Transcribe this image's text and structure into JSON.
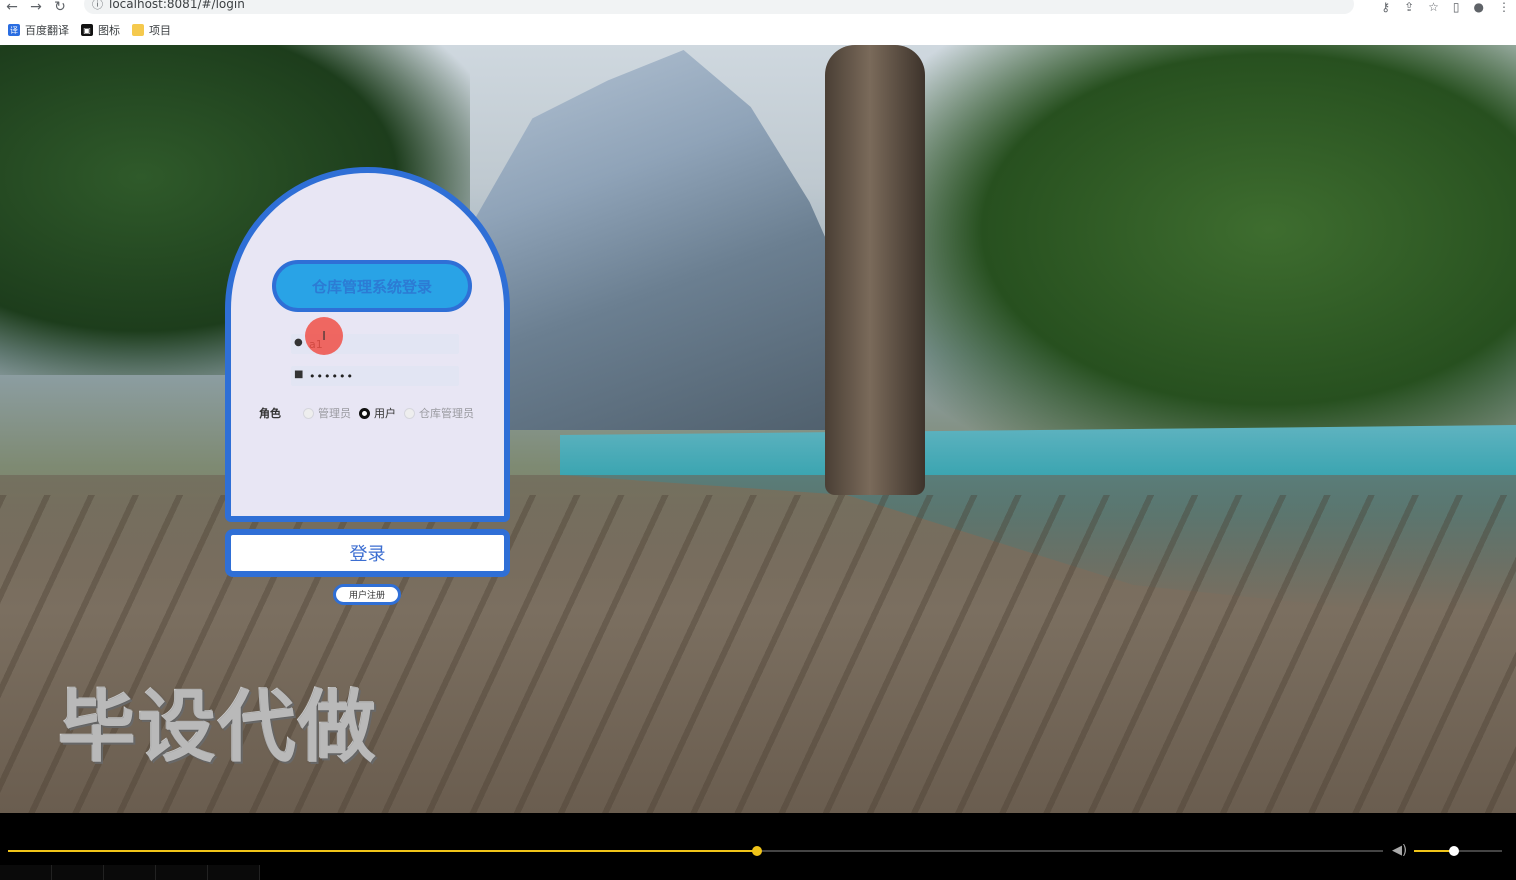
{
  "browser": {
    "url": "localhost:8081/#/login",
    "bookmarks": [
      {
        "label": "百度翻译",
        "icon": "translate-icon"
      },
      {
        "label": "图标",
        "icon": "image-icon"
      },
      {
        "label": "项目",
        "icon": "folder-icon"
      }
    ]
  },
  "login": {
    "title": "仓库管理系统登录",
    "username_value": "a1",
    "password_value": "••••••",
    "role_label": "角色",
    "roles": [
      {
        "label": "管理员",
        "checked": false
      },
      {
        "label": "用户",
        "checked": true
      },
      {
        "label": "仓库管理员",
        "checked": false
      }
    ],
    "login_button": "登录",
    "register_button": "用户注册"
  },
  "watermark": "毕设代做",
  "player": {
    "progress": 0.545,
    "volume": 0.45
  },
  "colors": {
    "accent_blue": "#2f6fd6",
    "title_pill": "#29a3e6",
    "progress": "#f0c419"
  }
}
